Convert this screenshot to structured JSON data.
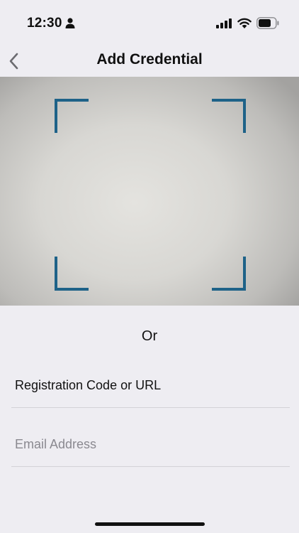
{
  "status_bar": {
    "time": "12:30",
    "icons": [
      "person-icon",
      "cellular-signal-icon",
      "wifi-icon",
      "battery-icon"
    ]
  },
  "nav": {
    "title": "Add Credential",
    "back_icon": "chevron-left-icon"
  },
  "scanner": {
    "frame_color": "#1e6288"
  },
  "divider_label": "Or",
  "form": {
    "registration": {
      "placeholder": "Registration Code or URL",
      "value": ""
    },
    "email": {
      "placeholder": "Email Address",
      "value": ""
    }
  }
}
